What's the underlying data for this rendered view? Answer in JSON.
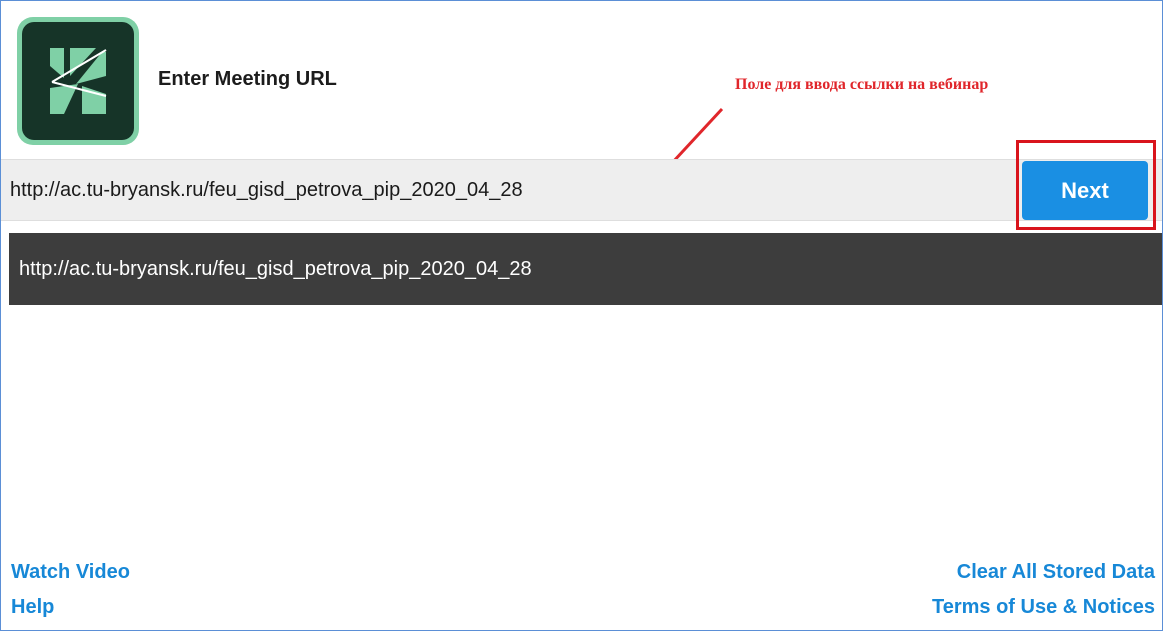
{
  "header": {
    "title": "Enter Meeting URL",
    "logo_icon": "adobe-connect-icon"
  },
  "annotation": {
    "text": "Поле для ввода ссылки на вебинар",
    "color": "#e0262b"
  },
  "url_field": {
    "value": "http://ac.tu-bryansk.ru/feu_gisd_petrova_pip_2020_04_28"
  },
  "next_button": {
    "label": "Next",
    "color": "#1a8fe3"
  },
  "suggestions": [
    "http://ac.tu-bryansk.ru/feu_gisd_petrova_pip_2020_04_28"
  ],
  "footer": {
    "watch_video": "Watch Video",
    "help": "Help",
    "clear_data": "Clear All Stored Data",
    "terms": "Terms of Use & Notices",
    "link_color": "#1788d7"
  }
}
